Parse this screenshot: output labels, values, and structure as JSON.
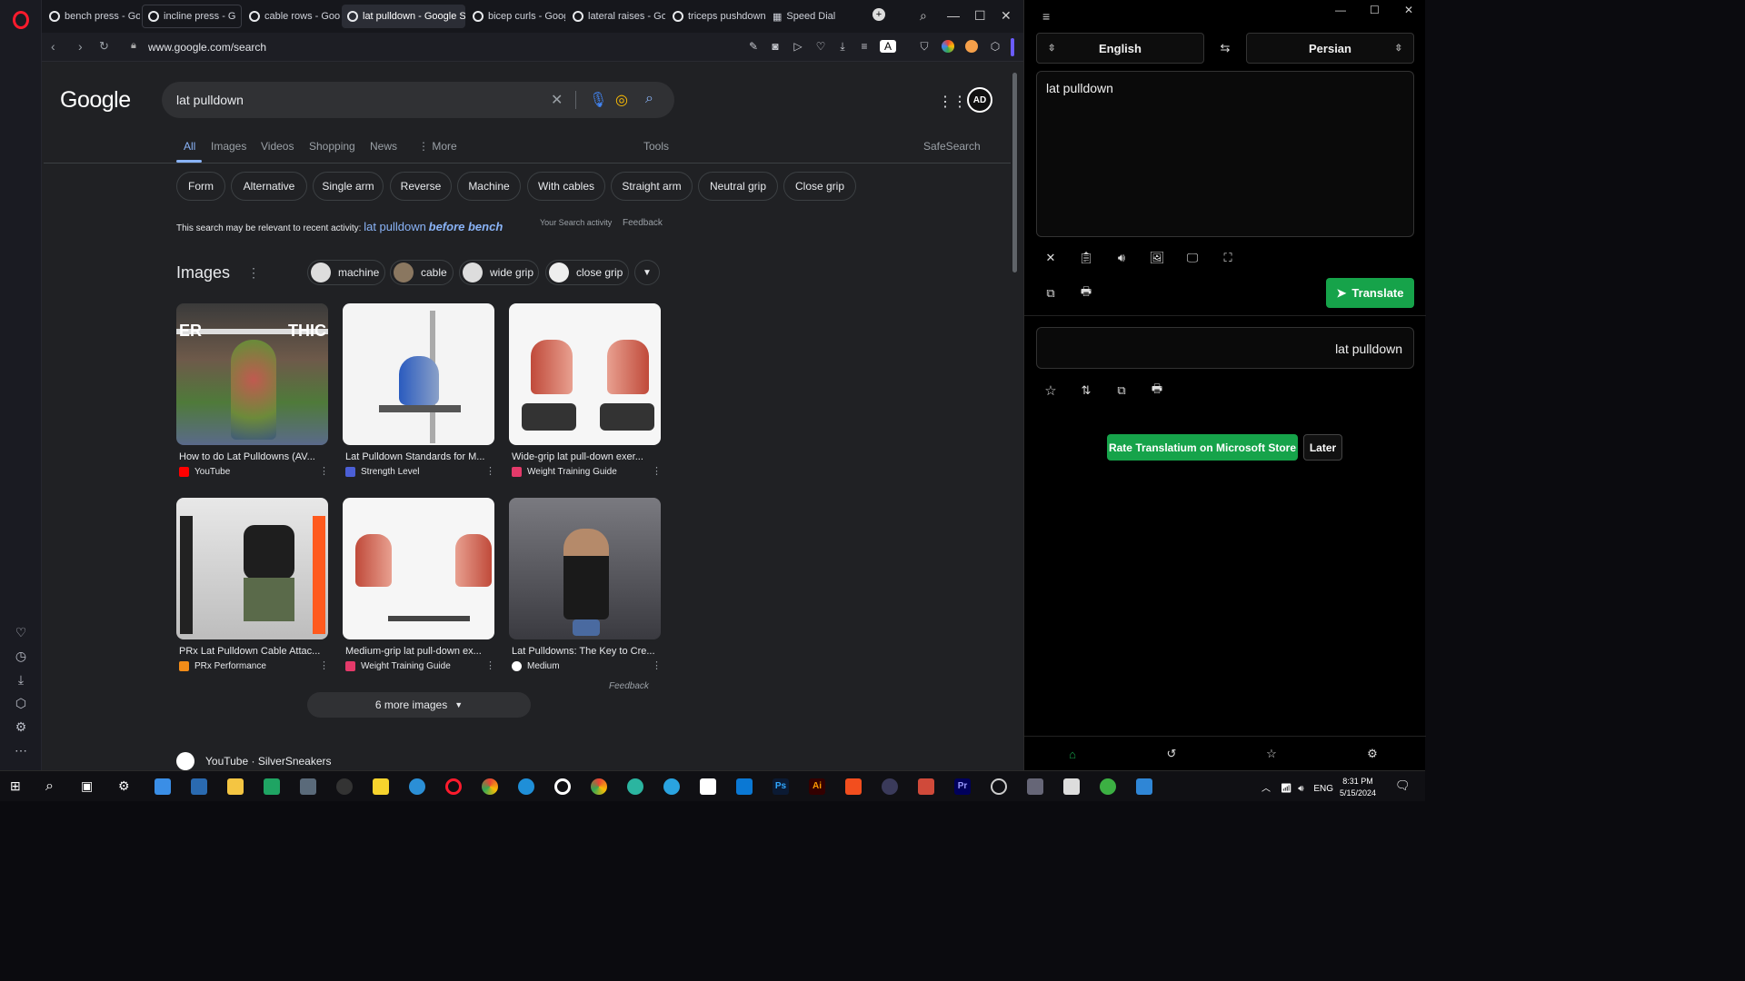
{
  "browser": {
    "tabs": [
      {
        "label": "bench press - Goog"
      },
      {
        "label": "incline press - G",
        "close": "✕"
      },
      {
        "label": "cable rows - Google"
      },
      {
        "label": "lat pulldown - Google Sea"
      },
      {
        "label": "bicep curls - Google"
      },
      {
        "label": "lateral raises - Goog"
      },
      {
        "label": "triceps pushdown -"
      },
      {
        "label": "Speed Dial"
      }
    ],
    "url": "www.google.com/search"
  },
  "google": {
    "logo": "Google",
    "query": "lat pulldown",
    "nav": [
      "All",
      "Images",
      "Videos",
      "Shopping",
      "News",
      "More"
    ],
    "tools": "Tools",
    "safesearch": "SafeSearch",
    "chips": [
      "Form",
      "Alternative",
      "Single arm",
      "Reverse",
      "Machine",
      "With cables",
      "Straight arm",
      "Neutral grip",
      "Close grip"
    ],
    "relevance_prefix": "This search may be relevant to recent activity:",
    "relevance_q": "lat pulldown",
    "relevance_b": "before bench",
    "activity": "Your Search activity",
    "feedback": "Feedback",
    "images_title": "Images",
    "image_chips": [
      "machine",
      "cable",
      "wide grip",
      "close grip"
    ],
    "images": [
      {
        "caption": "How to do Lat Pulldowns (AV...",
        "source": "YouTube",
        "overlay_left": "ER",
        "overlay_right": "THIC"
      },
      {
        "caption": "Lat Pulldown Standards for M...",
        "source": "Strength Level"
      },
      {
        "caption": "Wide-grip lat pull-down exer...",
        "source": "Weight Training Guide"
      },
      {
        "caption": "PRx Lat Pulldown Cable Attac...",
        "source": "PRx Performance"
      },
      {
        "caption": "Medium-grip lat pull-down ex...",
        "source": "Weight Training Guide"
      },
      {
        "caption": "Lat Pulldowns: The Key to Cre...",
        "source": "Medium"
      }
    ],
    "feedback2": "Feedback",
    "more_images": "6 more images",
    "result": "YouTube · SilverSneakers"
  },
  "translator": {
    "from": "English",
    "to": "Persian",
    "source_text": "lat pulldown",
    "translate_label": "Translate",
    "output_text": "lat pulldown",
    "rate_label": "Rate Translatium on Microsoft Store",
    "later_label": "Later"
  },
  "taskbar": {
    "lang": "ENG",
    "time": "8:31 PM",
    "date": "5/15/2024"
  }
}
